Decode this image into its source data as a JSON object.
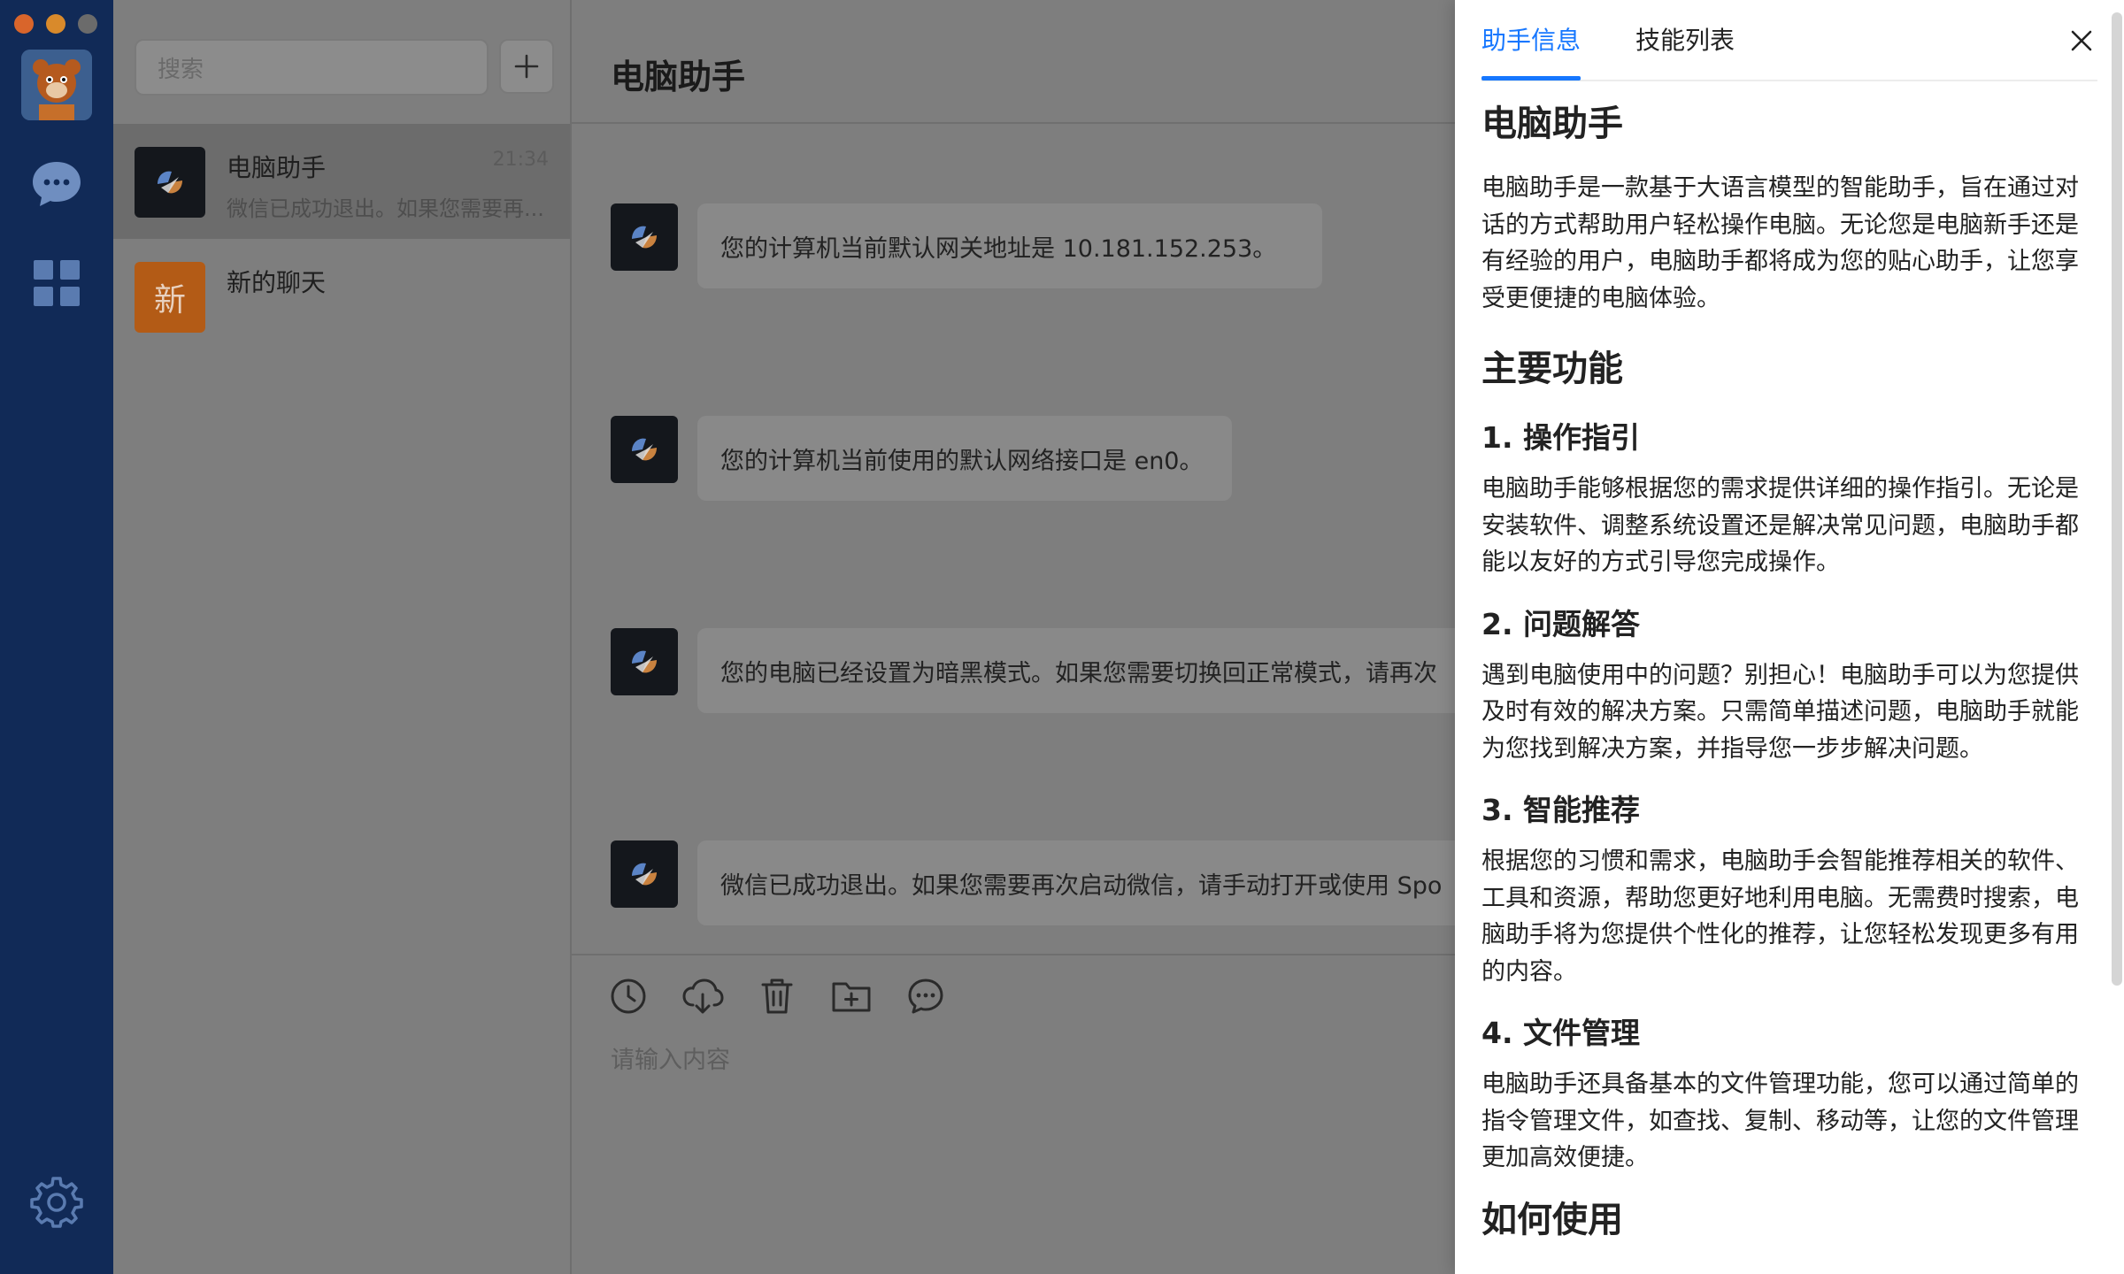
{
  "sidebar": {
    "icons": [
      "chat-bubble-icon",
      "apps-grid-icon",
      "settings-gear-icon"
    ]
  },
  "conversation_list": {
    "search_placeholder": "搜索",
    "add_button": "+",
    "items": [
      {
        "title": "电脑助手",
        "time": "21:34",
        "preview": "微信已成功退出。如果您需要再..."
      },
      {
        "avatar_text": "新",
        "title": "新的聊天"
      }
    ]
  },
  "chat": {
    "title": "电脑助手",
    "messages": [
      {
        "text": "您的计算机当前默认网关地址是 10.181.152.253。"
      },
      {
        "text": "您的计算机当前使用的默认网络接口是 en0。"
      },
      {
        "text": "您的电脑已经设置为暗黑模式。如果您需要切换回正常模式，请再次"
      },
      {
        "text": "微信已成功退出。如果您需要再次启动微信，请手动打开或使用 Spo"
      }
    ],
    "toolbar": [
      "history-clock-icon",
      "cloud-download-icon",
      "trash-icon",
      "folder-add-icon",
      "more-chat-icon"
    ],
    "input_placeholder": "请输入内容"
  },
  "drawer": {
    "tabs": [
      "助手信息",
      "技能列表"
    ],
    "active_tab": "助手信息",
    "title": "电脑助手",
    "intro": "电脑助手是一款基于大语言模型的智能助手，旨在通过对话的方式帮助用户轻松操作电脑。无论您是电脑新手还是有经验的用户，电脑助手都将成为您的贴心助手，让您享受更便捷的电脑体验。",
    "features_heading": "主要功能",
    "features": [
      {
        "title": "1. 操作指引",
        "body": "电脑助手能够根据您的需求提供详细的操作指引。无论是安装软件、调整系统设置还是解决常见问题，电脑助手都能以友好的方式引导您完成操作。"
      },
      {
        "title": "2. 问题解答",
        "body": "遇到电脑使用中的问题？别担心！电脑助手可以为您提供及时有效的解决方案。只需简单描述问题，电脑助手就能为您找到解决方案，并指导您一步步解决问题。"
      },
      {
        "title": "3. 智能推荐",
        "body": "根据您的习惯和需求，电脑助手会智能推荐相关的软件、工具和资源，帮助您更好地利用电脑。无需费时搜索，电脑助手将为您提供个性化的推荐，让您轻松发现更多有用的内容。"
      },
      {
        "title": "4. 文件管理",
        "body": "电脑助手还具备基本的文件管理功能，您可以通过简单的指令管理文件，如查找、复制、移动等，让您的文件管理更加高效便捷。"
      }
    ],
    "next_heading": "如何使用"
  },
  "colors": {
    "accent": "#1677ff",
    "rail": "#112a57",
    "overlay": "#7e7e7e"
  }
}
